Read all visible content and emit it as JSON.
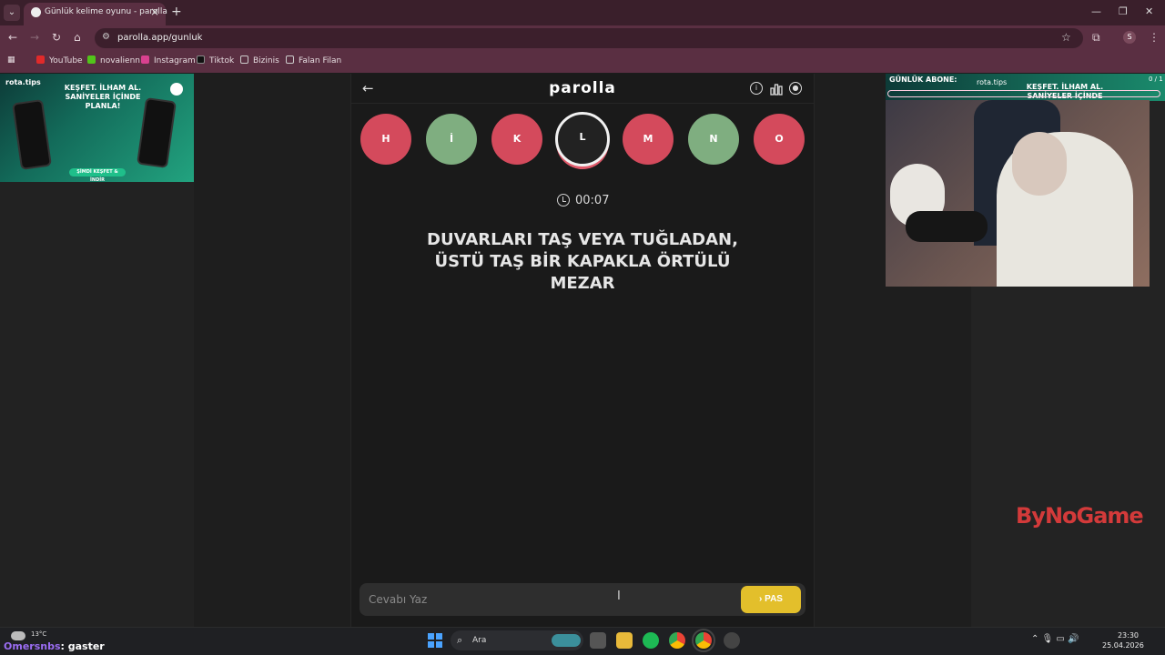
{
  "browser": {
    "tab_title": "Günlük kelime oyunu - parolla",
    "url": "parolla.app/gunluk",
    "profile_initial": "S",
    "bookmarks": [
      {
        "label": "YouTube",
        "color": "#e02a2a"
      },
      {
        "label": "novalienn",
        "color": "#52c41a"
      },
      {
        "label": "Instagram",
        "color": "#d9418f"
      },
      {
        "label": "Tiktok",
        "color": "#111111"
      },
      {
        "label": "Bizinis",
        "color": "folder"
      },
      {
        "label": "Falan Filan",
        "color": "folder"
      }
    ]
  },
  "game": {
    "brand": "parolla",
    "letters": [
      {
        "char": "H",
        "state": "wrong"
      },
      {
        "char": "İ",
        "state": "correct"
      },
      {
        "char": "K",
        "state": "wrong"
      },
      {
        "char": "L",
        "state": "active"
      },
      {
        "char": "M",
        "state": "wrong"
      },
      {
        "char": "N",
        "state": "correct"
      },
      {
        "char": "O",
        "state": "wrong"
      }
    ],
    "timer": "00:07",
    "question": "DUVARLARI TAŞ VEYA TUĞLADAN, ÜSTÜ TAŞ BİR KAPAKLA ÖRTÜLÜ MEZAR",
    "answer_placeholder": "Cevabı Yaz",
    "pass_button_label": "PAS",
    "colors": {
      "wrong": "#d44a5c",
      "correct": "#7fae80",
      "accent": "#e3bf2b"
    }
  },
  "stream_overlay": {
    "left_ad": {
      "logo": "rota.tips",
      "headline": "KEŞFET. İLHAM AL. SANİYELER İÇİNDE PLANLA!",
      "cta": "ŞİMDİ KEŞFET & İNDİR"
    },
    "right_ad": {
      "sub_label": "GÜNLÜK ABONE:",
      "logo": "rota.tips",
      "headline": "KEŞFET. İLHAM AL. SANİYELER İÇİNDE PLANLA!",
      "sub_count": "0 / 1"
    },
    "sponsor": "ByNoGame",
    "chat": {
      "user": "Omersnbs",
      "message": ": gaster"
    }
  },
  "taskbar": {
    "temperature": "13°C",
    "search_text": "Ara",
    "time": "23:30",
    "date": "25.04.2026"
  }
}
